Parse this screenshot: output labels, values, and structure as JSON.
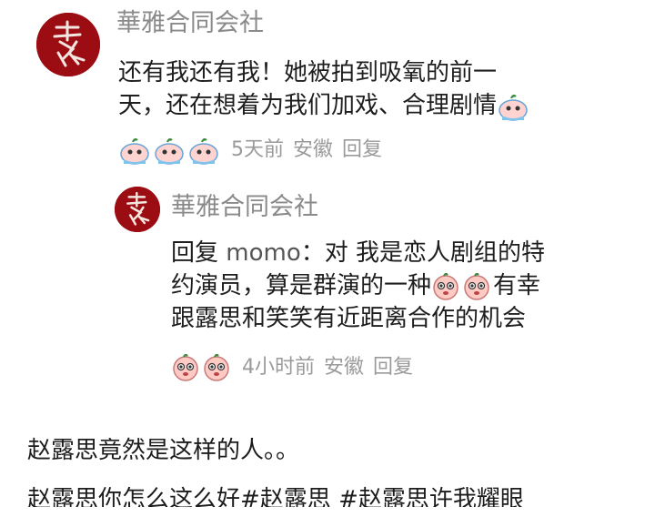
{
  "main_comment": {
    "username": "華雅合同会社",
    "text_line_1": "还有我还有我！她被拍到吸氧的前一",
    "text_line_2": "天，还在想着为我们加戏、合理剧情",
    "meta": {
      "time": "5天前",
      "location": "安徽",
      "reply_label": "回复"
    }
  },
  "reply_comment": {
    "username": "華雅合同会社",
    "reply_prefix": "回复",
    "mention": "momo",
    "text_line_1_rest": "：对 我是恋人剧组的特",
    "text_line_2": "约演员，算是群演的一种",
    "text_line_2_tail": "有幸",
    "text_line_3": "跟露思和笑笑有近距离合作的机会",
    "meta": {
      "time": "4小时前",
      "location": "安徽",
      "reply_label": "回复"
    }
  },
  "post": {
    "line_1": "赵露思竟然是这样的人。。",
    "line_2_prefix": "赵露思你怎么这么好",
    "hashtag_1": "#赵露思",
    "hashtag_2": "#赵露思许我耀眼"
  },
  "colors": {
    "avatar_bg": "#9b0d12",
    "username": "#8a8a8a",
    "meta": "#9a9a9a",
    "text": "#1e1e1e"
  },
  "icons": {
    "crying_emoji": "crying-face-emoji",
    "pleading_emoji": "pleading-face-emoji"
  }
}
